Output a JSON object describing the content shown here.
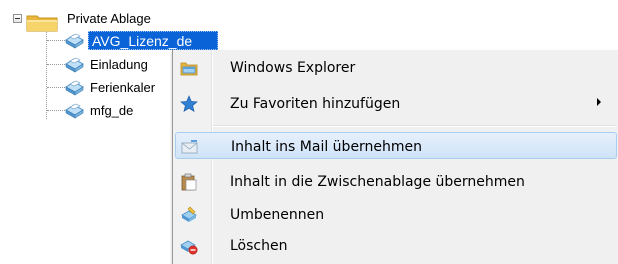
{
  "tree": {
    "root": {
      "label": "Private Ablage",
      "icon": "folder-icon",
      "expanded": true
    },
    "items": [
      {
        "label": "AVG_Lizenz_de",
        "icon": "document-icon",
        "selected": true
      },
      {
        "label": "Einladung",
        "icon": "document-icon",
        "selected": false
      },
      {
        "label": "Ferienkaler",
        "icon": "document-icon",
        "selected": false
      },
      {
        "label": "mfg_de",
        "icon": "document-icon",
        "selected": false
      }
    ]
  },
  "context_menu": {
    "items": [
      {
        "label": "Windows Explorer",
        "icon": "windows-explorer-icon",
        "submenu": false,
        "highlighted": false
      },
      {
        "label": "Zu Favoriten hinzufügen",
        "icon": "star-icon",
        "submenu": true,
        "highlighted": false
      },
      {
        "label": "Inhalt ins Mail übernehmen",
        "icon": "mail-icon",
        "submenu": false,
        "highlighted": true
      },
      {
        "label": "Inhalt in die Zwischenablage übernehmen",
        "icon": "clipboard-icon",
        "submenu": false,
        "highlighted": false
      },
      {
        "label": "Umbenennen",
        "icon": "rename-icon",
        "submenu": false,
        "highlighted": false
      },
      {
        "label": "Löschen",
        "icon": "delete-icon",
        "submenu": false,
        "highlighted": false
      }
    ]
  },
  "colors": {
    "selection": "#0a64d8",
    "menu_background": "#f0f0f0",
    "menu_highlight": "#cfe3f8",
    "menu_highlight_border": "#a8cdef",
    "folder": "#f3c74a",
    "document": "#5a9fd4"
  }
}
